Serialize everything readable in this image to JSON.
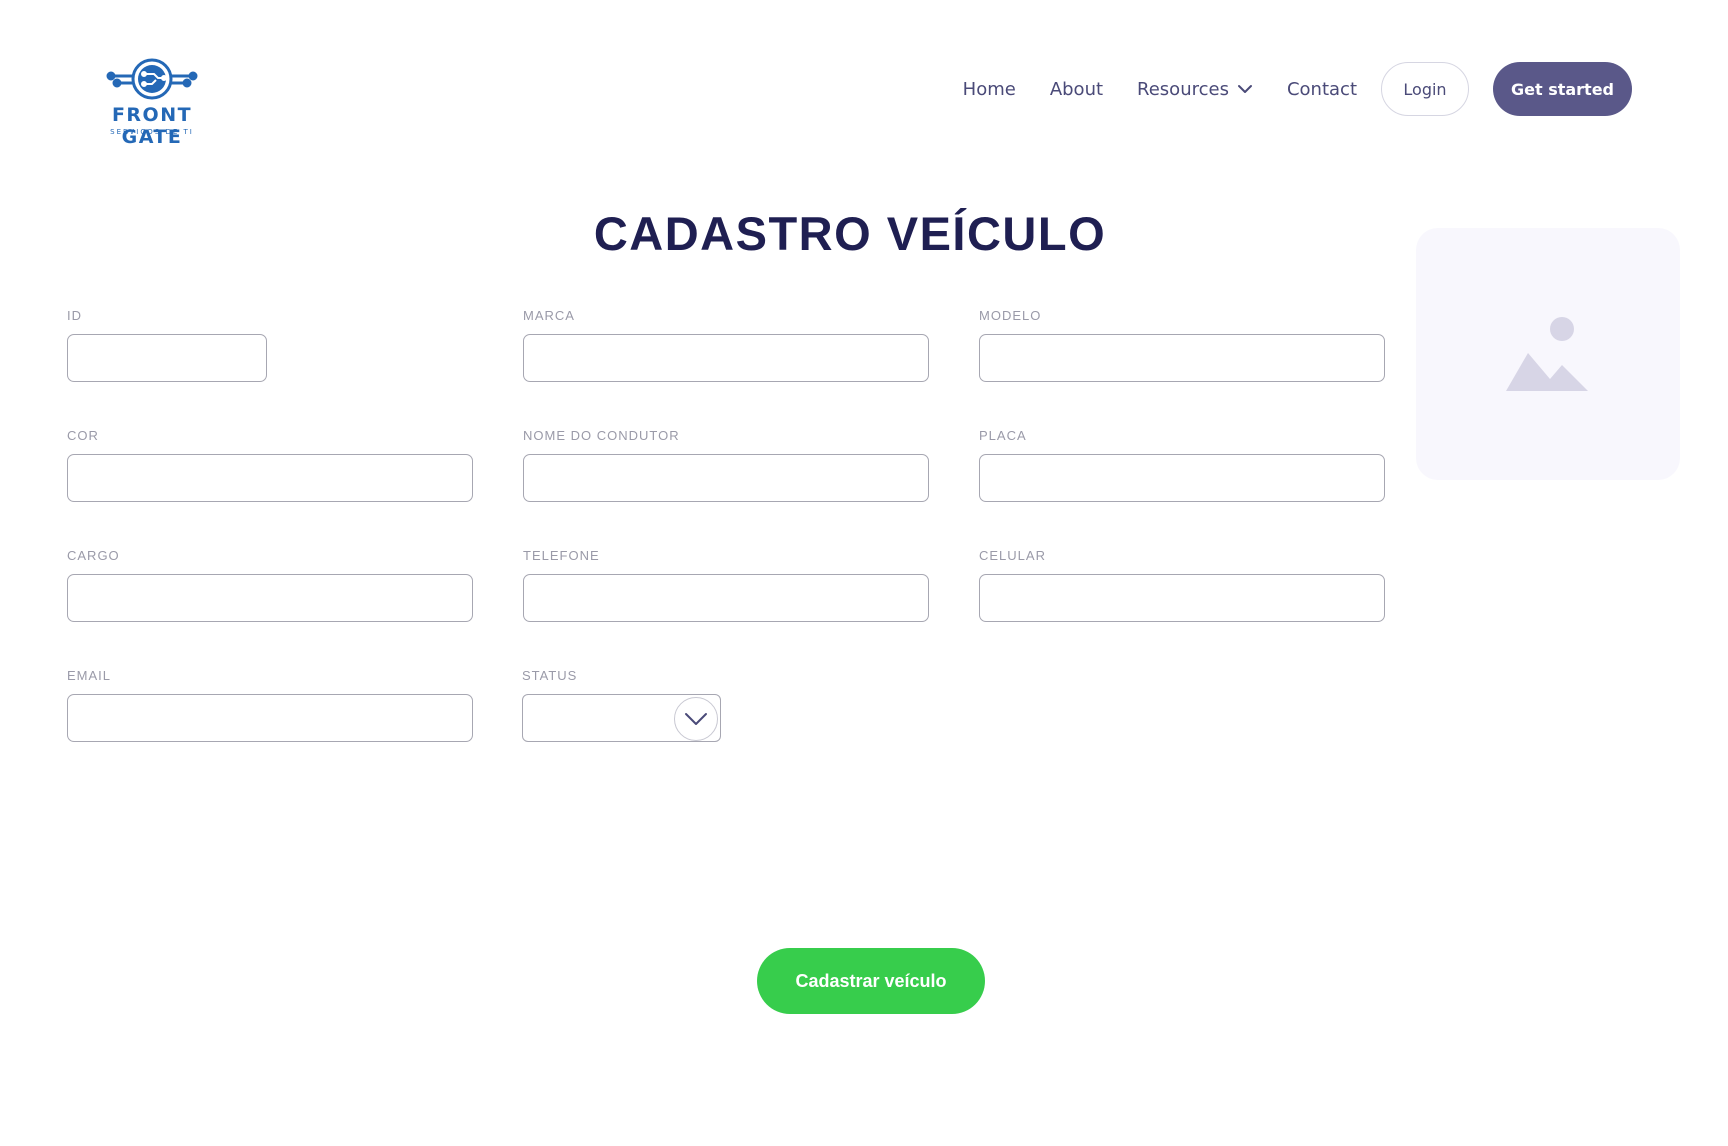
{
  "brand": {
    "name": "FRONT GATE",
    "tagline": "SERVIÇOS DE TI",
    "color": "#2468b6"
  },
  "nav": {
    "home": "Home",
    "about": "About",
    "resources": "Resources",
    "contact": "Contact",
    "login": "Login",
    "get_started": "Get started"
  },
  "page": {
    "title": "CADASTRO VEÍCULO"
  },
  "form": {
    "id": {
      "label": "ID",
      "value": ""
    },
    "marca": {
      "label": "MARCA",
      "value": ""
    },
    "modelo": {
      "label": "MODELO",
      "value": ""
    },
    "cor": {
      "label": "COR",
      "value": ""
    },
    "nome_condutor": {
      "label": "NOME DO CONDUTOR",
      "value": ""
    },
    "placa": {
      "label": "PLACA",
      "value": ""
    },
    "cargo": {
      "label": "CARGO",
      "value": ""
    },
    "telefone": {
      "label": "TELEFONE",
      "value": ""
    },
    "celular": {
      "label": "CELULAR",
      "value": ""
    },
    "email": {
      "label": "EMAIL",
      "value": ""
    },
    "status": {
      "label": "STATUS",
      "value": ""
    },
    "submit": "Cadastrar veículo"
  },
  "colors": {
    "primary": "#5a5889",
    "submit": "#37cd4c",
    "title": "#1f1f52"
  },
  "icons": {
    "logo": "circuit-globe-icon",
    "resources_dropdown": "chevron-down-icon",
    "status_dropdown": "chevron-down-icon",
    "placeholder": "image-placeholder-icon"
  }
}
